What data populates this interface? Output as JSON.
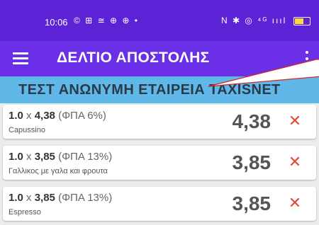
{
  "status_bar": {
    "time": "10:06",
    "left_icons": "© ⊞ ≅ ⊕ ⊕ •",
    "right_icons": "N ✱ ◎ ⁴ᴳ ıııl",
    "battery_level": 0.62,
    "battery_label": "62"
  },
  "app_bar": {
    "title": "ΔΕΛΤΙΟ ΑΠΟΣΤΟΛΗΣ",
    "menu_icon": "hamburger-menu-icon",
    "more_icon": "more-vert-icon"
  },
  "company": {
    "name": "ΤΕΣΤ ΑΝΩΝΥΜΗ ΕΤΑΙΡΕΙΑ TAXISNET"
  },
  "items": [
    {
      "qty": "1.0",
      "x": "x",
      "price": "4,38",
      "vat": "(ΦΠΑ 6%)",
      "description": "Capussino",
      "total": "4,38",
      "delete_glyph": "✕"
    },
    {
      "qty": "1.0",
      "x": "x",
      "price": "3,85",
      "vat": "(ΦΠΑ 13%)",
      "description": "Γαλλικος με γαλα και φρουτα",
      "total": "3,85",
      "delete_glyph": "✕"
    },
    {
      "qty": "1.0",
      "x": "x",
      "price": "3,85",
      "vat": "(ΦΠΑ 13%)",
      "description": "Espresso",
      "total": "3,85",
      "delete_glyph": "✕"
    }
  ],
  "colors": {
    "status_bar": "#5b22d6",
    "app_bar": "#6a2fe6",
    "company_bar": "#5fb8e8",
    "delete": "#e0493b",
    "callout_line": "#d92020"
  }
}
